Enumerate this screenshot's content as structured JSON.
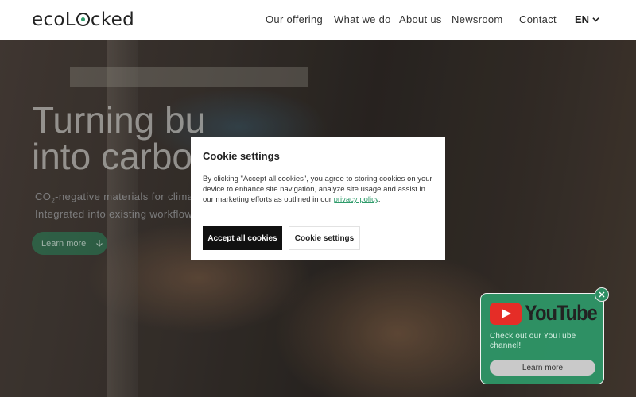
{
  "header": {
    "logo": {
      "prefix": "ecoL",
      "suffix": "cked"
    },
    "nav": [
      "Our offering",
      "What we do",
      "About us",
      "Newsroom",
      "Contact"
    ],
    "language": "EN"
  },
  "hero": {
    "title": "Turning bu\ninto carbo",
    "subtitle_line1_pre": "CO",
    "subtitle_line1_sub": "2",
    "subtitle_line1_post": "-negative materials for climat",
    "subtitle_line2": "Integrated into existing workflow",
    "cta_label": "Learn more"
  },
  "cookie_dialog": {
    "title": "Cookie settings",
    "text_before_link": "By clicking \"Accept all cookies\", you agree to storing cookies on your device to enhance site navigation, analyze site usage and assist in our marketing efforts as outlined in our ",
    "link_text": "privacy policy",
    "text_after_link": ".",
    "accept_label": "Accept all cookies",
    "settings_label": "Cookie settings"
  },
  "youtube_widget": {
    "logo_text": "YouTube",
    "text": "Check out our YouTube channel!",
    "button_label": "Learn more"
  },
  "colors": {
    "accent": "#2e9b6a",
    "youtube_red": "#e52d27",
    "dark_button": "#111111"
  }
}
